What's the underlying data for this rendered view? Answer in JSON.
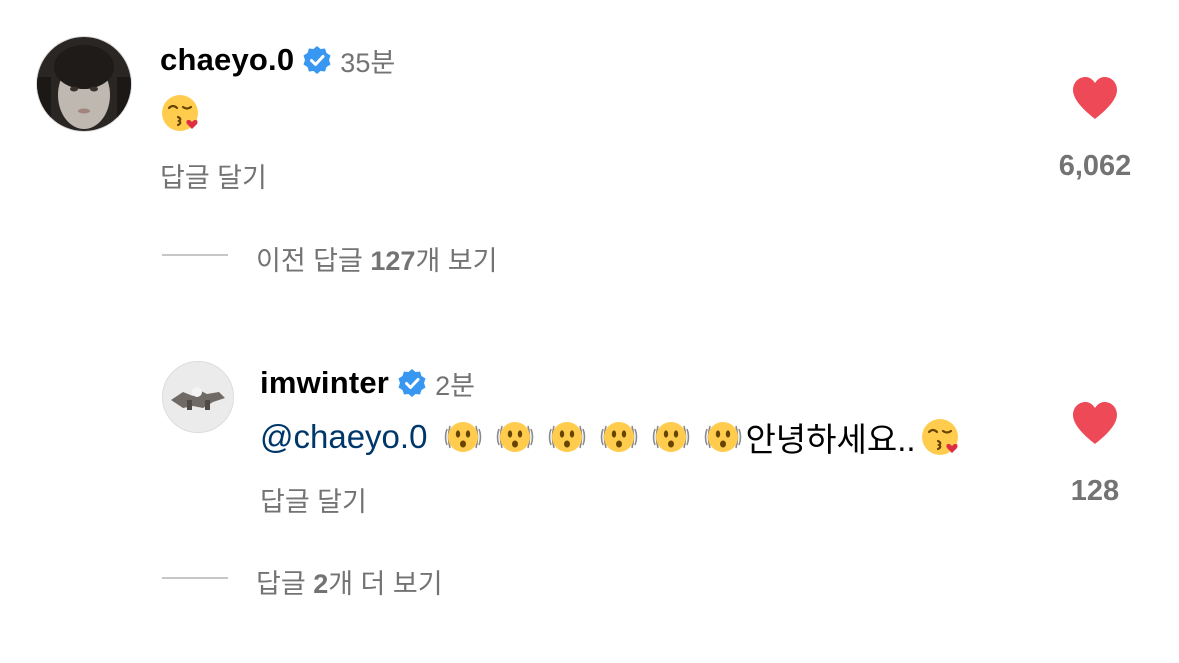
{
  "comment": {
    "username": "chaeyo.0",
    "time": "35분",
    "body_emoji": "kissing-heart-emoji",
    "reply_label": "답글 달기",
    "like_count": "6,062",
    "heart_color": "#ed4956"
  },
  "view_previous": {
    "prefix": "이전 답글 ",
    "count": "127",
    "suffix": "개 보기"
  },
  "reply": {
    "username": "imwinter",
    "time": "2분",
    "mention": "@chaeyo.0",
    "text": "안녕하세요..",
    "reply_label": "답글 달기",
    "like_count": "128"
  },
  "view_more": {
    "prefix": "답글 ",
    "count": "2",
    "suffix": "개 더 보기"
  },
  "colors": {
    "verified_blue": "#3897f0",
    "mention_blue": "#00376b",
    "secondary_gray": "#737373"
  }
}
